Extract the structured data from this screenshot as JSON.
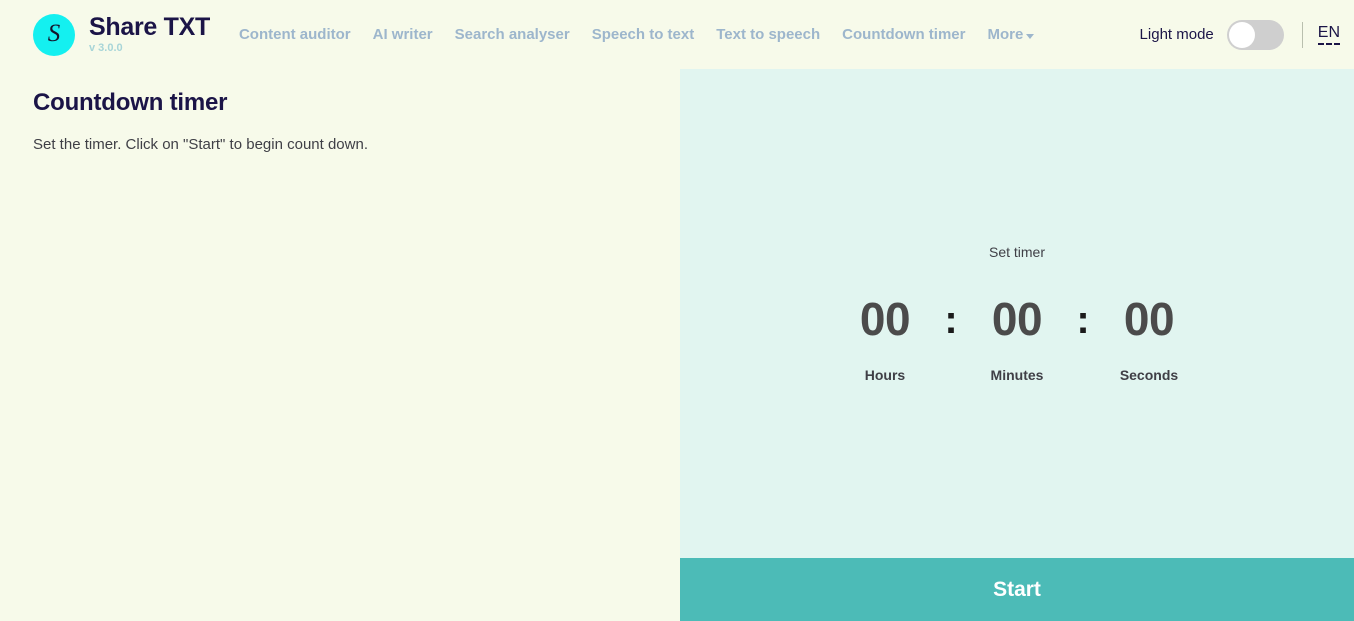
{
  "header": {
    "brand": {
      "logo_glyph": "S",
      "title": "Share TXT",
      "version": "v 3.0.0"
    },
    "nav_items": [
      {
        "label": "Content auditor"
      },
      {
        "label": "AI writer"
      },
      {
        "label": "Search analyser"
      },
      {
        "label": "Speech to text"
      },
      {
        "label": "Text to speech"
      },
      {
        "label": "Countdown timer"
      },
      {
        "label": "More"
      }
    ],
    "theme_toggle_label": "Light mode",
    "theme_toggle_state": "off",
    "language": "EN"
  },
  "main": {
    "title": "Countdown timer",
    "subtitle": "Set the timer. Click on \"Start\" to begin count down."
  },
  "timer": {
    "set_timer_label": "Set timer",
    "separator": ":",
    "fields": [
      {
        "value": "00",
        "label": "Hours"
      },
      {
        "value": "00",
        "label": "Minutes"
      },
      {
        "value": "00",
        "label": "Seconds"
      }
    ],
    "start_button_label": "Start"
  },
  "colors": {
    "page_background": "#f7faea",
    "panel_background": "#e1f5f0",
    "accent": "#4cbbb7",
    "logo": "#14f0f0",
    "nav_link": "#9db6cc",
    "heading": "#1b1447"
  }
}
